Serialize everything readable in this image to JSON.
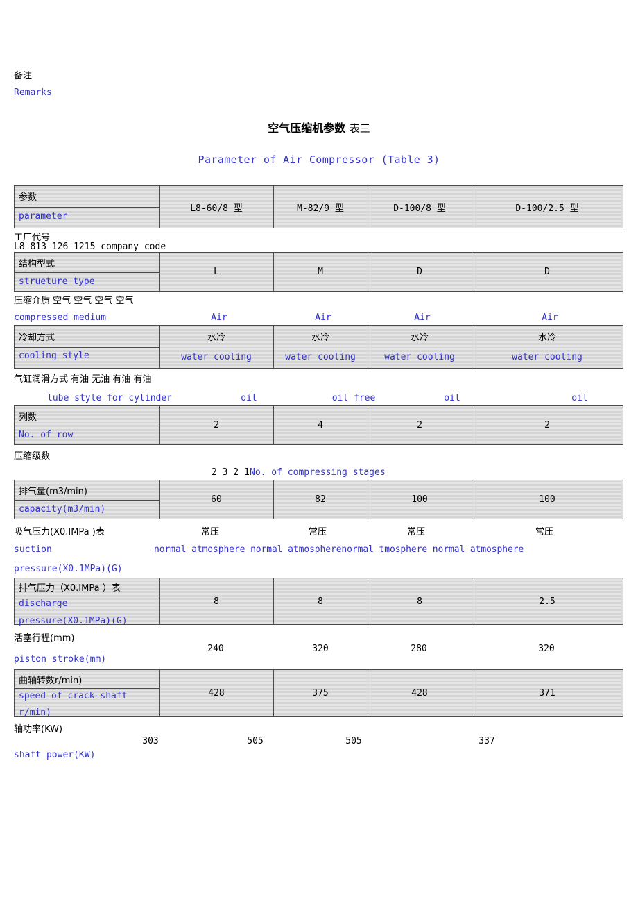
{
  "document": {
    "remarks_cn": "备注",
    "remarks_en": "Remarks",
    "title_cn": "空气压缩机参数",
    "title_cn_sub": "表三",
    "title_en": "Parameter of Air Compressor (Table 3)"
  },
  "table": {
    "header": {
      "param_cn": "参数",
      "param_en": "parameter",
      "models": [
        "L8-60/8 型",
        "M-82/9 型",
        "D-100/8 型",
        "D-100/2.5 型"
      ]
    },
    "rows": [
      {
        "style": "plain",
        "label_cn": "工厂代号",
        "label_en": "L8 813 126 1215 company code",
        "label_en_color": "#000000",
        "values": []
      },
      {
        "style": "boxed",
        "label_cn": "结构型式",
        "label_en": "strueture type",
        "values": [
          "L",
          "M",
          "D",
          "D"
        ]
      },
      {
        "style": "plain",
        "label_cn": "压缩介质 空气 空气 空气 空气",
        "label_en": "compressed medium",
        "values": [
          "Air",
          "Air",
          "Air",
          "Air"
        ],
        "values_color": "#3333cc"
      },
      {
        "style": "boxed",
        "label_cn": "冷却方式",
        "label_en": "cooling style",
        "values_cn": [
          "水冷",
          "水冷",
          "水冷",
          "水冷"
        ],
        "values_en": [
          "water cooling",
          "water cooling",
          "water cooling",
          "water cooling"
        ]
      },
      {
        "style": "plain",
        "label_cn": "气缸润滑方式 有油 无油 有油 有油",
        "label_en": "lube style for cylinder",
        "values": [
          "oil",
          "oil free",
          "oil",
          "oil"
        ],
        "values_color": "#3333cc"
      },
      {
        "style": "boxed",
        "label_cn": "列数",
        "label_en": "No. of row",
        "values": [
          "2",
          "4",
          "2",
          "2"
        ]
      },
      {
        "style": "plain",
        "label_cn": "压缩级数",
        "inline_numbers": "2 3 2 1",
        "label_en": "No. of compressing stages",
        "values": []
      },
      {
        "style": "boxed",
        "label_cn": "排气量(m3/min)",
        "label_en": "capacity(m3/min)",
        "values": [
          "60",
          "82",
          "100",
          "100"
        ]
      },
      {
        "style": "plain",
        "label_cn": "吸气压力(X0.IMPa )表",
        "label_en": "suction",
        "label_en2": "pressure(X0.1MPa)(G)",
        "values_cn": [
          "常压",
          "常压",
          "常压",
          "常压"
        ],
        "values_en_run": "normal atmosphere normal atmospherenormal tmosphere normal atmosphere"
      },
      {
        "style": "boxed",
        "label_cn": "排气压力（X0.IMPa ）表",
        "label_en": "discharge",
        "label_en2": "pressure(X0.1MPa)(G)",
        "values": [
          "8",
          "8",
          "8",
          "2.5"
        ]
      },
      {
        "style": "plain",
        "label_cn": "活塞行程(mm)",
        "label_en": "piston stroke(mm)",
        "values": [
          "240",
          "320",
          "280",
          "320"
        ]
      },
      {
        "style": "boxed",
        "label_cn": "曲轴转数r/min)",
        "label_en": "speed of crack-shaft",
        "label_en2": "r/min)",
        "values": [
          "428",
          "375",
          "428",
          "371"
        ]
      },
      {
        "style": "plain",
        "label_cn": "轴功率(KW)",
        "label_en": "shaft power(KW)",
        "values": [
          "303",
          "505",
          "505",
          "337"
        ]
      }
    ]
  },
  "colors": {
    "english_text": "#3333cc",
    "cell_fill": "#d5d5d5",
    "border": "#4a4a4a"
  }
}
